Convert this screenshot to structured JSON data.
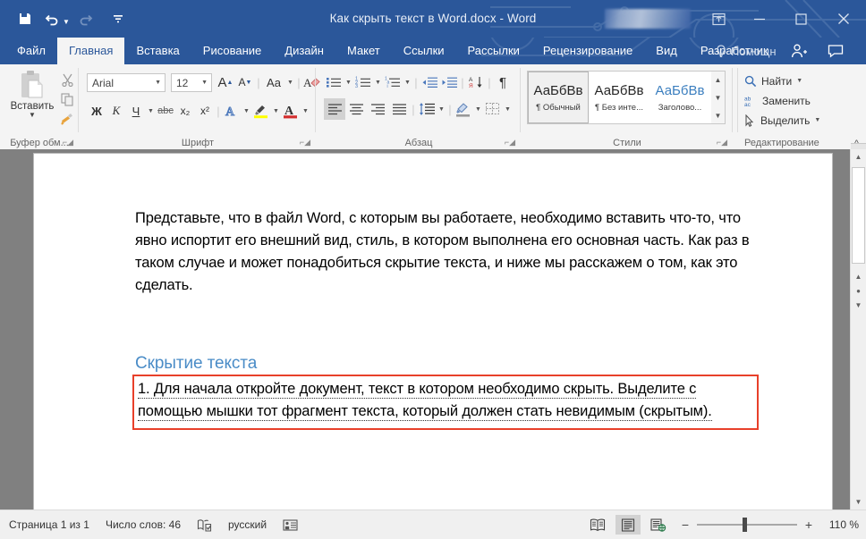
{
  "window": {
    "title": "Как скрыть текст в Word.docx  -  Word",
    "quick_access": [
      {
        "name": "save",
        "icon": "save-icon"
      },
      {
        "name": "undo",
        "icon": "undo-icon"
      },
      {
        "name": "redo",
        "icon": "redo-icon"
      },
      {
        "name": "customize-qat",
        "icon": "chevron-down-icon"
      }
    ],
    "controls": [
      {
        "name": "ribbon-display-options",
        "icon": "ribbon-options-icon"
      },
      {
        "name": "minimize",
        "icon": "minimize-icon"
      },
      {
        "name": "maximize",
        "icon": "maximize-icon"
      },
      {
        "name": "close",
        "icon": "close-icon"
      }
    ]
  },
  "tabs": [
    {
      "label": "Файл",
      "active": false
    },
    {
      "label": "Главная",
      "active": true
    },
    {
      "label": "Вставка",
      "active": false
    },
    {
      "label": "Рисование",
      "active": false
    },
    {
      "label": "Дизайн",
      "active": false
    },
    {
      "label": "Макет",
      "active": false
    },
    {
      "label": "Ссылки",
      "active": false
    },
    {
      "label": "Рассылки",
      "active": false
    },
    {
      "label": "Рецензирование",
      "active": false
    },
    {
      "label": "Вид",
      "active": false
    },
    {
      "label": "Разработчик",
      "active": false
    }
  ],
  "tellme": {
    "label": "Помощн"
  },
  "ribbon": {
    "clipboard": {
      "group_label": "Буфер обм...",
      "paste_label": "Вставить",
      "items": [
        "cut",
        "copy",
        "format-painter"
      ]
    },
    "font": {
      "group_label": "Шрифт",
      "font_name": "Arial",
      "font_size": "12",
      "bold": "Ж",
      "italic": "К",
      "underline": "Ч",
      "strikethrough": "abc",
      "subscript": "x₂",
      "superscript": "x²",
      "grow_font": "A",
      "shrink_font": "A",
      "change_case": "Aa"
    },
    "paragraph": {
      "group_label": "Абзац"
    },
    "styles": {
      "group_label": "Стили",
      "items": [
        {
          "preview": "АаБбВв",
          "name": "¶ Обычный",
          "selected": true,
          "heading": false
        },
        {
          "preview": "АаБбВв",
          "name": "¶ Без инте...",
          "selected": false,
          "heading": false
        },
        {
          "preview": "АаБбВв",
          "name": "Заголово...",
          "selected": false,
          "heading": true
        }
      ]
    },
    "editing": {
      "group_label": "Редактирование",
      "find": "Найти",
      "replace": "Заменить",
      "select": "Выделить"
    }
  },
  "document": {
    "paragraph1": "Представьте, что в файл Word, с которым вы работаете, необходимо вставить что-то, что явно испортит его внешний вид, стиль, в котором выполнена его основная часть. Как раз в таком случае и может понадобиться скрытие текста, и ниже мы расскажем о том, как это сделать.",
    "heading": "Скрытие текста",
    "highlighted_text": "1. Для начала откройте документ, текст в котором необходимо скрыть. Выделите с помощью мышки тот фрагмент текста, который должен стать невидимым (скрытым).",
    "highlight_color": "#e8402a"
  },
  "status_bar": {
    "page": "Страница 1 из 1",
    "words": "Число слов: 46",
    "language": "русский",
    "proofing_icon": "proofing-icon",
    "accessibility_icon": "accessibility-icon",
    "views": [
      {
        "name": "read-mode",
        "icon": "read-mode-icon",
        "selected": false
      },
      {
        "name": "print-layout",
        "icon": "print-layout-icon",
        "selected": true
      },
      {
        "name": "web-layout",
        "icon": "web-layout-icon",
        "selected": false
      }
    ],
    "zoom_out": "−",
    "zoom_in": "+",
    "zoom_value": "110 %"
  },
  "colors": {
    "titlebar": "#2b579a",
    "ribbon": "#f4f4f4",
    "doc_background": "#808080",
    "heading_blue": "#4a8cc7",
    "highlight_red": "#e8402a"
  }
}
